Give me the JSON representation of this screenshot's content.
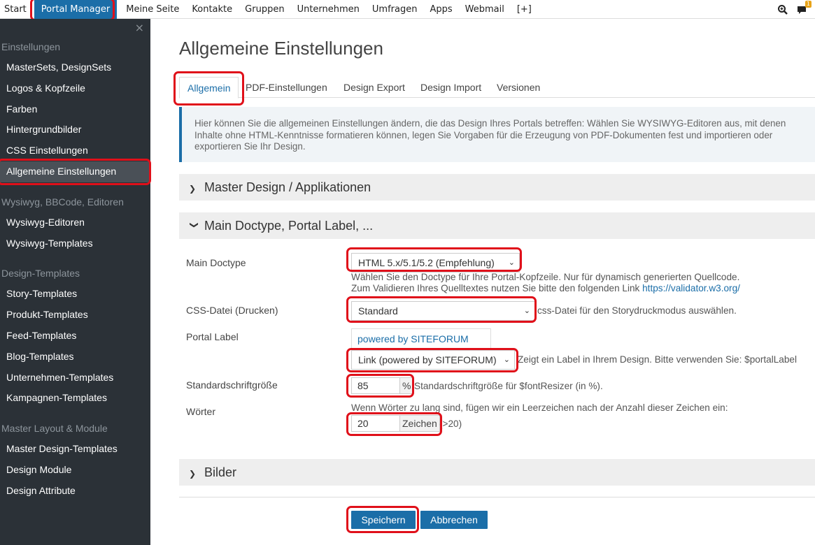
{
  "topnav": {
    "items": [
      "Start",
      "Portal Manager",
      "Meine Seite",
      "Kontakte",
      "Gruppen",
      "Unternehmen",
      "Umfragen",
      "Apps",
      "Webmail",
      "[+]"
    ],
    "active_index": 1,
    "notification_count": "1",
    "icons": [
      "search-icon",
      "message-icon"
    ]
  },
  "sidebar": {
    "close_label": "×",
    "groups": [
      {
        "title": "Einstellungen",
        "items": [
          "MasterSets, DesignSets",
          "Logos & Kopfzeile",
          "Farben",
          "Hintergrundbilder",
          "CSS Einstellungen",
          "Allgemeine Einstellungen"
        ]
      },
      {
        "title": "Wysiwyg, BBCode, Editoren",
        "items": [
          "Wysiwyg-Editoren",
          "Wysiwyg-Templates"
        ]
      },
      {
        "title": "Design-Templates",
        "items": [
          "Story-Templates",
          "Produkt-Templates",
          "Feed-Templates",
          "Blog-Templates",
          "Unternehmen-Templates",
          "Kampagnen-Templates"
        ]
      },
      {
        "title": "Master Layout & Module",
        "items": [
          "Master Design-Templates",
          "Design Module",
          "Design Attribute"
        ]
      }
    ],
    "active_item": "Allgemeine Einstellungen"
  },
  "main": {
    "title": "Allgemeine Einstellungen",
    "tabs": [
      "Allgemein",
      "PDF-Einstellungen",
      "Design Export",
      "Design Import",
      "Versionen"
    ],
    "active_tab": "Allgemein",
    "info_lines": [
      "Hier können Sie die allgemeinen Einstellungen ändern, die das Design Ihres Portals betreffen: Wählen Sie WYSIWYG-Editoren aus, mit denen",
      "Inhalte ohne HTML-Kenntnisse formatieren können, legen Sie Vorgaben für die Erzeugung von PDF-Dokumenten fest und importieren oder",
      "exportieren Sie Ihr Design."
    ],
    "panels": {
      "master_design": "Master Design / Applikationen",
      "main_doctype": "Main Doctype, Portal Label, ...",
      "bilder": "Bilder"
    },
    "form": {
      "doctype": {
        "label": "Main Doctype",
        "value": "HTML 5.x/5.1/5.2 (Empfehlung)",
        "help1": "Wählen Sie den Doctype für Ihre Portal-Kopfzeile. Nur für dynamisch generierten Quellcode.",
        "help2": "Zum Validieren Ihres Quelltextes nutzen Sie bitte den folgenden Link",
        "link": "https://validator.w3.org/"
      },
      "css_file": {
        "label": "CSS-Datei (Drucken)",
        "value": "Standard",
        "help": "css-Datei für den Storydruckmodus auswählen."
      },
      "portal_label": {
        "label": "Portal Label",
        "preview": "powered by SITEFORUM",
        "value": "Link (powered by SITEFORUM)",
        "help": "Zeigt ein Label in Ihrem Design. Bitte verwenden Sie: $portalLabel"
      },
      "font_size": {
        "label": "Standardschriftgröße",
        "value": "85",
        "unit": "%",
        "help": "Standardschriftgröße für $fontResizer (in %)."
      },
      "words": {
        "label": "Wörter",
        "help": "Wenn Wörter zu lang sind, fügen wir ein Leerzeichen nach der Anzahl dieser Zeichen ein:",
        "value": "20",
        "unit": "Zeichen",
        "hint": "(>20)"
      }
    },
    "buttons": {
      "save": "Speichern",
      "cancel": "Abbrechen"
    }
  },
  "colors": {
    "accent": "#1b6ea8",
    "sidebar_bg": "#2b3137",
    "highlight": "#e0101a"
  }
}
